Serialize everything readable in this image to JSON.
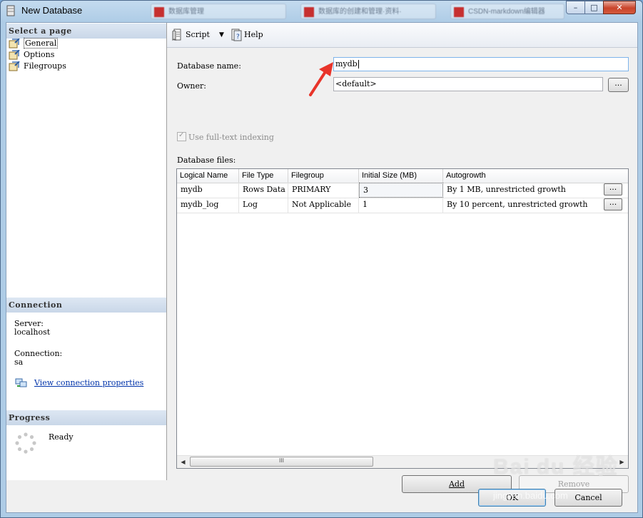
{
  "window": {
    "title": "New Database",
    "background_tabs": [
      "数据库管理",
      "数据库的创建和管理·资料·",
      "CSDN-markdown编辑器"
    ],
    "controls": {
      "minimize": "–",
      "maximize": "□",
      "close": "✕"
    }
  },
  "sidebar": {
    "select_page_heading": "Select a page",
    "pages": [
      {
        "label": "General",
        "selected": true
      },
      {
        "label": "Options",
        "selected": false
      },
      {
        "label": "Filegroups",
        "selected": false
      }
    ],
    "connection_heading": "Connection",
    "server_label": "Server:",
    "server_value": "localhost",
    "connection_label": "Connection:",
    "connection_value": "sa",
    "view_connection_link": "View connection properties",
    "progress_heading": "Progress",
    "progress_status": "Ready"
  },
  "toolbar": {
    "script_label": "Script",
    "help_label": "Help"
  },
  "form": {
    "database_name_label": "Database name:",
    "database_name_value": "mydb",
    "owner_label": "Owner:",
    "owner_value": "<default>",
    "browse_label": "...",
    "fulltext_label": "Use full-text indexing",
    "fulltext_checked": true,
    "fulltext_enabled": false,
    "database_files_label": "Database files:"
  },
  "files_table": {
    "columns": [
      "Logical Name",
      "File Type",
      "Filegroup",
      "Initial Size (MB)",
      "Autogrowth"
    ],
    "rows": [
      [
        "mydb",
        "Rows Data",
        "PRIMARY",
        "3",
        "By 1 MB, unrestricted growth"
      ],
      [
        "mydb_log",
        "Log",
        "Not Applicable",
        "1",
        "By 10 percent, unrestricted growth"
      ]
    ],
    "row_button_label": "...",
    "scroll_thumb_grip": "III"
  },
  "buttons": {
    "add": "Add",
    "remove": "Remove",
    "ok": "OK",
    "cancel": "Cancel"
  },
  "watermark": {
    "brand": "Bai du 经验",
    "url": "jingyan.baidu.com"
  },
  "colors": {
    "accent_arrow": "#e8342a",
    "link": "#0033aa",
    "section_header": "#c9d7e8"
  }
}
